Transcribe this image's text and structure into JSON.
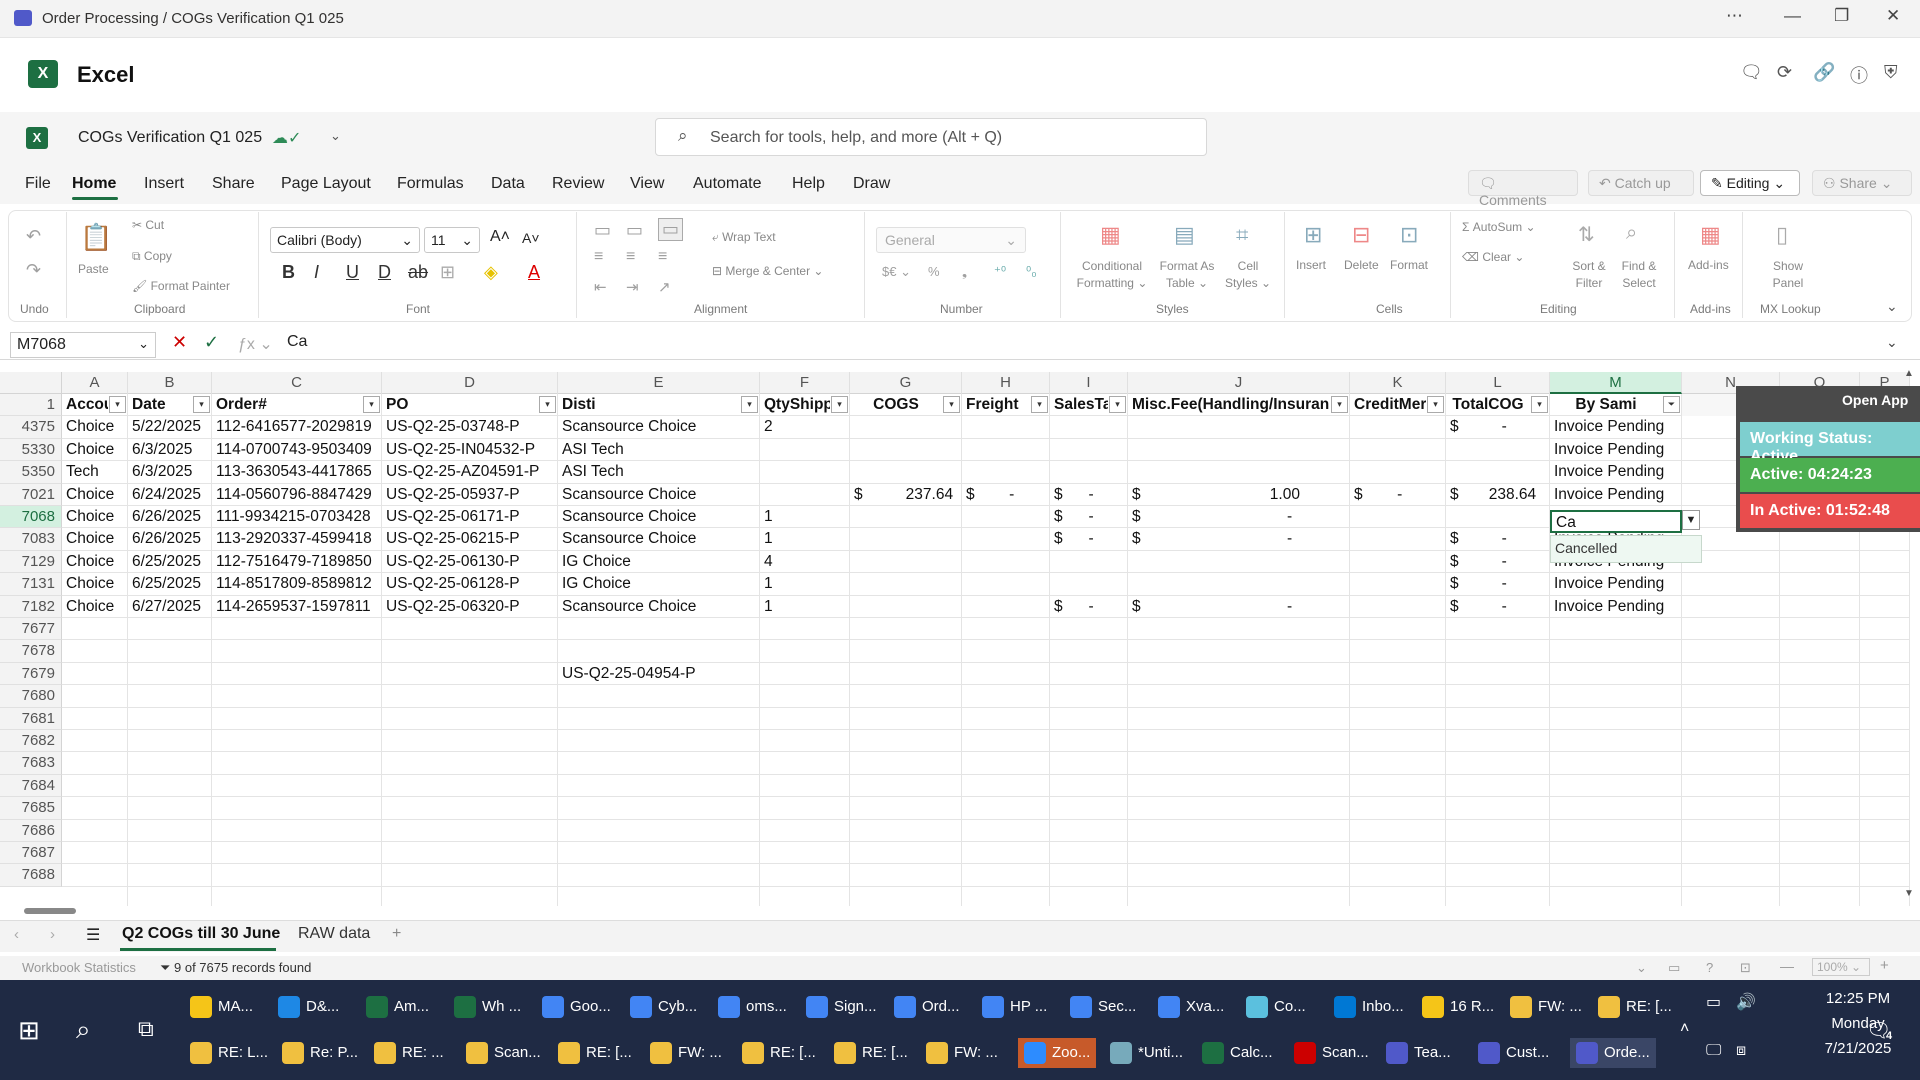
{
  "window": {
    "title": "Order Processing / COGs Verification Q1 025"
  },
  "app": {
    "name": "Excel"
  },
  "doc": {
    "name": "COGs Verification Q1 025"
  },
  "search": {
    "placeholder": "Search for tools, help, and more (Alt + Q)"
  },
  "menu": [
    "File",
    "Home",
    "Insert",
    "Share",
    "Page Layout",
    "Formulas",
    "Data",
    "Review",
    "View",
    "Automate",
    "Help",
    "Draw"
  ],
  "menu_right": {
    "comments": "Comments",
    "catchup": "Catch up",
    "editing": "Editing",
    "share": "Share"
  },
  "ribbon": {
    "undo_group": "Undo",
    "clipboard": {
      "paste": "Paste",
      "cut": "Cut",
      "copy": "Copy",
      "format_painter": "Format Painter",
      "group": "Clipboard"
    },
    "font": {
      "name": "Calibri (Body)",
      "size": "11",
      "group": "Font"
    },
    "alignment": {
      "wrap": "Wrap Text",
      "merge": "Merge & Center",
      "group": "Alignment"
    },
    "number": {
      "format": "General",
      "group": "Number"
    },
    "styles": {
      "cond": [
        "Conditional",
        "Formatting"
      ],
      "table": [
        "Format As",
        "Table"
      ],
      "cell": [
        "Cell",
        "Styles"
      ],
      "group": "Styles"
    },
    "cells": {
      "insert": "Insert",
      "delete": "Delete",
      "format": "Format",
      "group": "Cells"
    },
    "editing": {
      "autosum": "AutoSum",
      "clear": "Clear",
      "sort": [
        "Sort &",
        "Filter"
      ],
      "find": [
        "Find &",
        "Select"
      ],
      "group": "Editing"
    },
    "addins": {
      "label": "Add-ins",
      "group": "Add-ins"
    },
    "mx": {
      "label": [
        "Show",
        "Panel"
      ],
      "group": "MX Lookup"
    }
  },
  "formula": {
    "namebox": "M7068",
    "value": "Ca"
  },
  "columns": [
    "A",
    "B",
    "C",
    "D",
    "E",
    "F",
    "G",
    "H",
    "I",
    "J",
    "K",
    "L",
    "M",
    "N",
    "O",
    "P"
  ],
  "header_row": {
    "num": "1",
    "cells": [
      "Accou",
      "Date",
      "Order#",
      "PO",
      "Disti",
      "QtyShipp",
      "COGS",
      "Freight",
      "SalesTa",
      "Misc.Fee(Handling/Insuran",
      "CreditMer",
      "TotalCOG",
      "By Sami"
    ]
  },
  "rows": [
    {
      "num": "4375",
      "a": "Choice",
      "b": "5/22/2025",
      "c": "112-6416577-2029819",
      "d": "US-Q2-25-03748-P",
      "e": "Scansource Choice",
      "f": "2",
      "g": "",
      "h": "",
      "i": "",
      "j": "",
      "k": "",
      "l": "$          -",
      "m": "Invoice Pending"
    },
    {
      "num": "5330",
      "a": "Choice",
      "b": "6/3/2025",
      "c": "114-0700743-9503409",
      "d": "US-Q2-25-IN04532-P",
      "e": "ASI Tech",
      "f": "",
      "g": "",
      "h": "",
      "i": "",
      "j": "",
      "k": "",
      "l": "",
      "m": "Invoice Pending"
    },
    {
      "num": "5350",
      "a": "Tech",
      "b": "6/3/2025",
      "c": "113-3630543-4417865",
      "d": "US-Q2-25-AZ04591-P",
      "e": "ASI Tech",
      "f": "",
      "g": "",
      "h": "",
      "i": "",
      "j": "",
      "k": "",
      "l": "",
      "m": "Invoice Pending"
    },
    {
      "num": "7021",
      "a": "Choice",
      "b": "6/24/2025",
      "c": "114-0560796-8847429",
      "d": "US-Q2-25-05937-P",
      "e": "Scansource Choice",
      "f": "",
      "g": "$          237.64",
      "h": "$        -",
      "i": "$      -",
      "j": "$                              1.00",
      "k": "$        -",
      "l": "$       238.64",
      "m": "Invoice Pending"
    },
    {
      "num": "7068",
      "a": "Choice",
      "b": "6/26/2025",
      "c": "111-9934215-0703428",
      "d": "US-Q2-25-06171-P",
      "e": "Scansource Choice",
      "f": "1",
      "g": "",
      "h": "",
      "i": "$      -",
      "j": "$                                  -",
      "k": "",
      "l": "",
      "m": ""
    },
    {
      "num": "7083",
      "a": "Choice",
      "b": "6/26/2025",
      "c": "113-2920337-4599418",
      "d": "US-Q2-25-06215-P",
      "e": "Scansource Choice",
      "f": "1",
      "g": "",
      "h": "",
      "i": "$      -",
      "j": "$                                  -",
      "k": "",
      "l": "$          -",
      "m": "Invoice Pending"
    },
    {
      "num": "7129",
      "a": "Choice",
      "b": "6/25/2025",
      "c": "112-7516479-7189850",
      "d": "US-Q2-25-06130-P",
      "e": "IG Choice",
      "f": "4",
      "g": "",
      "h": "",
      "i": "",
      "j": "",
      "k": "",
      "l": "$          -",
      "m": "Invoice Pending"
    },
    {
      "num": "7131",
      "a": "Choice",
      "b": "6/25/2025",
      "c": "114-8517809-8589812",
      "d": "US-Q2-25-06128-P",
      "e": "IG Choice",
      "f": "1",
      "g": "",
      "h": "",
      "i": "",
      "j": "",
      "k": "",
      "l": "$          -",
      "m": "Invoice Pending"
    },
    {
      "num": "7182",
      "a": "Choice",
      "b": "6/27/2025",
      "c": "114-2659537-1597811",
      "d": "US-Q2-25-06320-P",
      "e": "Scansource Choice",
      "f": "1",
      "g": "",
      "h": "",
      "i": "$      -",
      "j": "$                                  -",
      "k": "",
      "l": "$          -",
      "m": "Invoice Pending"
    },
    {
      "num": "7677",
      "a": "",
      "b": "",
      "c": "",
      "d": "",
      "e": "",
      "f": "",
      "g": "",
      "h": "",
      "i": "",
      "j": "",
      "k": "",
      "l": "",
      "m": ""
    },
    {
      "num": "7678",
      "a": "",
      "b": "",
      "c": "",
      "d": "",
      "e": "",
      "f": "",
      "g": "",
      "h": "",
      "i": "",
      "j": "",
      "k": "",
      "l": "",
      "m": ""
    },
    {
      "num": "7679",
      "a": "",
      "b": "",
      "c": "",
      "d": "",
      "e": "US-Q2-25-04954-P",
      "f": "",
      "g": "",
      "h": "",
      "i": "",
      "j": "",
      "k": "",
      "l": "",
      "m": ""
    },
    {
      "num": "7680",
      "a": "",
      "b": "",
      "c": "",
      "d": "",
      "e": "",
      "f": "",
      "g": "",
      "h": "",
      "i": "",
      "j": "",
      "k": "",
      "l": "",
      "m": ""
    },
    {
      "num": "7681",
      "a": "",
      "b": "",
      "c": "",
      "d": "",
      "e": "",
      "f": "",
      "g": "",
      "h": "",
      "i": "",
      "j": "",
      "k": "",
      "l": "",
      "m": ""
    },
    {
      "num": "7682",
      "a": "",
      "b": "",
      "c": "",
      "d": "",
      "e": "",
      "f": "",
      "g": "",
      "h": "",
      "i": "",
      "j": "",
      "k": "",
      "l": "",
      "m": ""
    },
    {
      "num": "7683",
      "a": "",
      "b": "",
      "c": "",
      "d": "",
      "e": "",
      "f": "",
      "g": "",
      "h": "",
      "i": "",
      "j": "",
      "k": "",
      "l": "",
      "m": ""
    },
    {
      "num": "7684",
      "a": "",
      "b": "",
      "c": "",
      "d": "",
      "e": "",
      "f": "",
      "g": "",
      "h": "",
      "i": "",
      "j": "",
      "k": "",
      "l": "",
      "m": ""
    },
    {
      "num": "7685",
      "a": "",
      "b": "",
      "c": "",
      "d": "",
      "e": "",
      "f": "",
      "g": "",
      "h": "",
      "i": "",
      "j": "",
      "k": "",
      "l": "",
      "m": ""
    },
    {
      "num": "7686",
      "a": "",
      "b": "",
      "c": "",
      "d": "",
      "e": "",
      "f": "",
      "g": "",
      "h": "",
      "i": "",
      "j": "",
      "k": "",
      "l": "",
      "m": ""
    },
    {
      "num": "7687",
      "a": "",
      "b": "",
      "c": "",
      "d": "",
      "e": "",
      "f": "",
      "g": "",
      "h": "",
      "i": "",
      "j": "",
      "k": "",
      "l": "",
      "m": ""
    },
    {
      "num": "7688",
      "a": "",
      "b": "",
      "c": "",
      "d": "",
      "e": "",
      "f": "",
      "g": "",
      "h": "",
      "i": "",
      "j": "",
      "k": "",
      "l": "",
      "m": ""
    }
  ],
  "active_cell": {
    "value": "Ca",
    "suggestion": "Cancelled"
  },
  "overlay": {
    "open_app": "Open App",
    "working": "Working Status: Active",
    "active": "Active: 04:24:23",
    "inactive": "In Active: 01:52:48"
  },
  "sheets": {
    "tab1": "Q2 COGs till 30 June",
    "tab2": "RAW data"
  },
  "status": {
    "stats": "Workbook Statistics",
    "filter": "9 of 7675 records found",
    "zoom": "100%"
  },
  "taskbar": {
    "row1": [
      "MA...",
      "D&...",
      "Am...",
      "Wh ...",
      "Goo...",
      "Cyb...",
      "oms...",
      "Sign...",
      "Ord...",
      "HP ...",
      "Sec...",
      "Xva...",
      "Co...",
      "Inbo...",
      "16 R...",
      "FW: ...",
      "RE: [..."
    ],
    "row2": [
      "RE: L...",
      "Re: P...",
      "RE: ...",
      "Scan...",
      "RE: [...",
      "FW: ...",
      "RE: [...",
      "RE: [...",
      "FW: ...",
      "Zoo...",
      "*Unti...",
      "Calc...",
      "Scan...",
      "Tea...",
      "Cust...",
      "Orde..."
    ],
    "time": "12:25 PM",
    "day": "Monday",
    "date": "7/21/2025",
    "notif": "4"
  },
  "colors": {
    "excel_green": "#1d6f42",
    "working": "#7ecfcf",
    "active": "#4caf50",
    "inactive": "#e94d4d",
    "taskbar": "#1f2a44"
  }
}
